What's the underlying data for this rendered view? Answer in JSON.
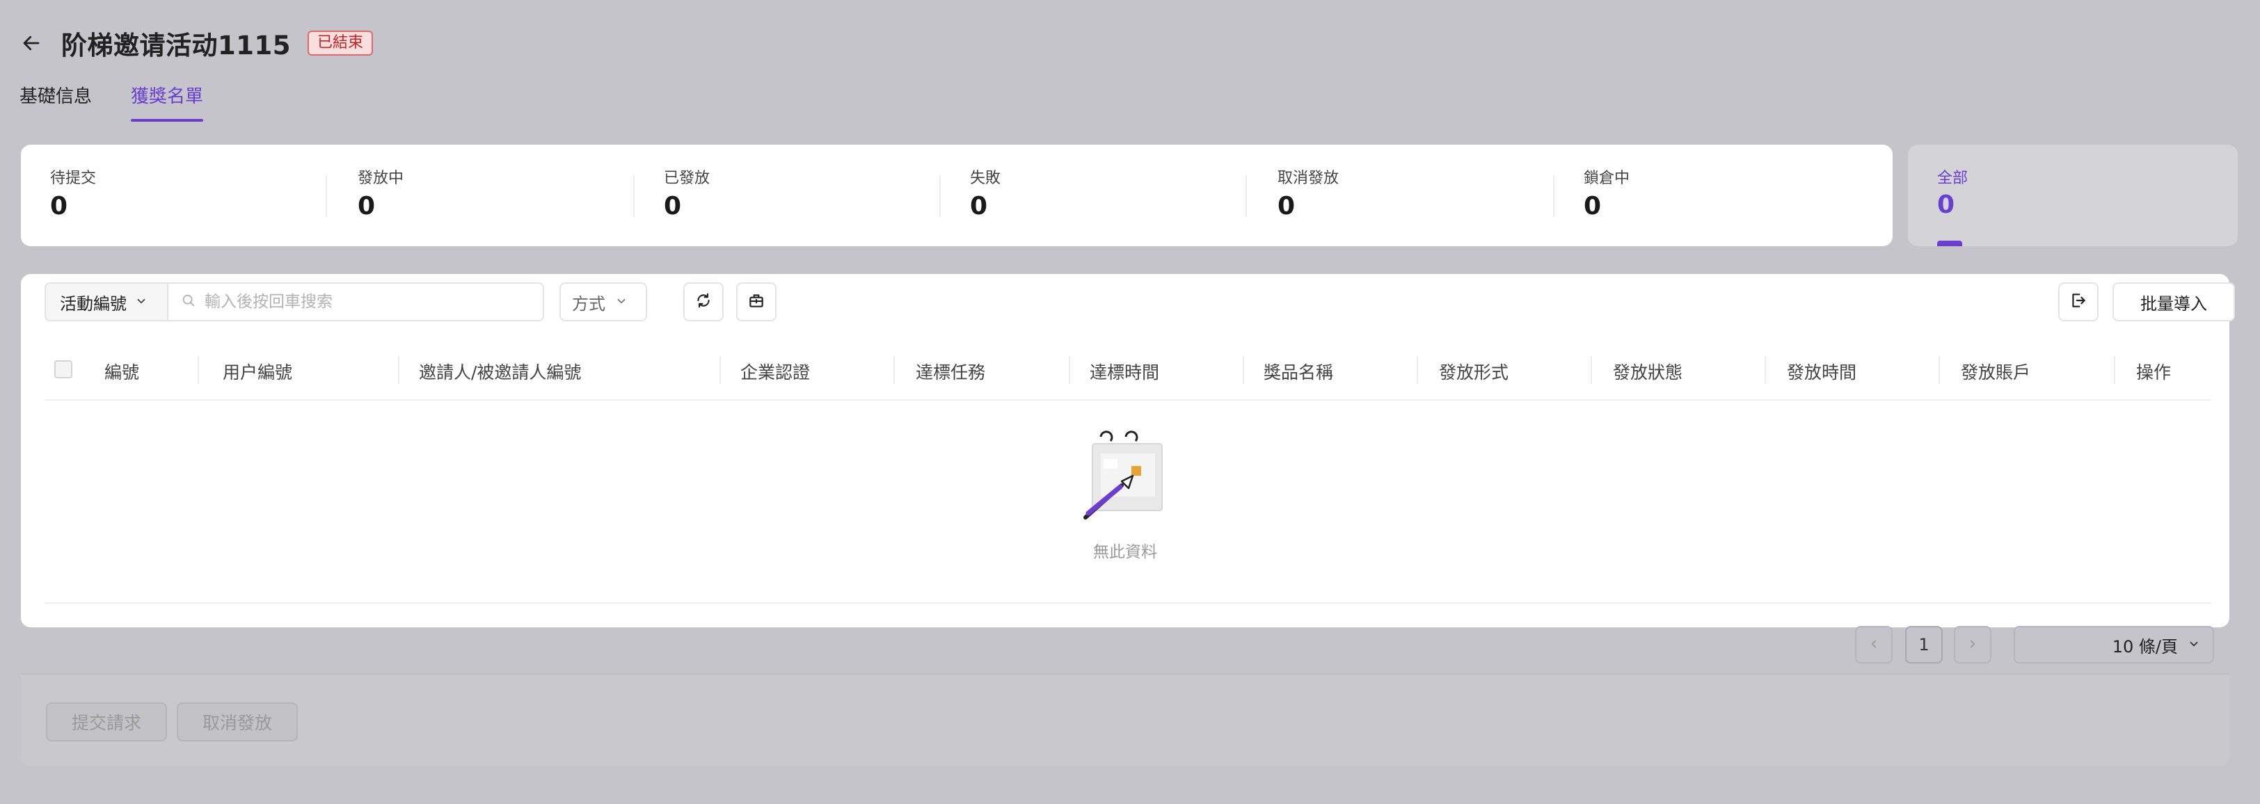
{
  "header": {
    "title": "阶梯邀请活动1115",
    "status": "已結束"
  },
  "tabs": [
    {
      "label": "基礎信息",
      "active": false
    },
    {
      "label": "獲獎名單",
      "active": true
    }
  ],
  "stats": [
    {
      "label": "待提交",
      "value": "0"
    },
    {
      "label": "發放中",
      "value": "0"
    },
    {
      "label": "已發放",
      "value": "0"
    },
    {
      "label": "失敗",
      "value": "0"
    },
    {
      "label": "取消發放",
      "value": "0"
    },
    {
      "label": "鎖倉中",
      "value": "0"
    }
  ],
  "all_stat": {
    "label": "全部",
    "value": "0"
  },
  "toolbar": {
    "filter_select": "活動編號",
    "search_placeholder": "輸入後按回車搜索",
    "method_select": "方式",
    "batch_import": "批量導入"
  },
  "table": {
    "columns": [
      "編號",
      "用户編號",
      "邀請人/被邀請人編號",
      "企業認證",
      "達標任務",
      "達標時間",
      "獎品名稱",
      "發放形式",
      "發放狀態",
      "發放時間",
      "發放賬戶",
      "操作"
    ],
    "empty_text": "無此資料"
  },
  "pagination": {
    "current_page": "1",
    "page_size": "10 條/頁"
  },
  "actions": {
    "submit": "提交請求",
    "cancel": "取消發放"
  },
  "colors": {
    "accent": "#6a3fd0",
    "danger": "#c52424"
  },
  "icons": [
    "back-arrow-icon",
    "chevron-down-icon",
    "search-icon",
    "refresh-icon",
    "export-icon",
    "logout-icon",
    "chevron-left-icon",
    "chevron-right-icon",
    "empty-illustration"
  ]
}
